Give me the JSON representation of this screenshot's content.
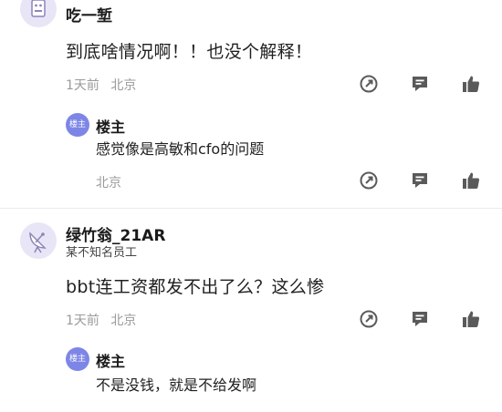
{
  "comments": [
    {
      "username": "吃一堑",
      "content": "到底啥情况啊！！也没个解释！",
      "time": "1天前",
      "location": "北京",
      "reply": {
        "badge": "楼主",
        "name": "楼主",
        "content": "感觉像是高敏和cfo的问题",
        "location": "北京"
      }
    },
    {
      "username": "绿竹翁_21AR",
      "subtitle": "某不知名员工",
      "content": "bbt连工资都发不出了么？这么惨",
      "time": "1天前",
      "location": "北京",
      "reply": {
        "badge": "楼主",
        "name": "楼主",
        "content": "不是没钱，就是不给发啊"
      }
    }
  ],
  "icons": {
    "forward": "forward-edit-icon",
    "comment": "comment-icon",
    "like": "thumbs-up-icon",
    "color": "#5a5a5a"
  },
  "colors": {
    "op_badge": "#7d86e6",
    "meta_text": "#9a9a9a"
  }
}
